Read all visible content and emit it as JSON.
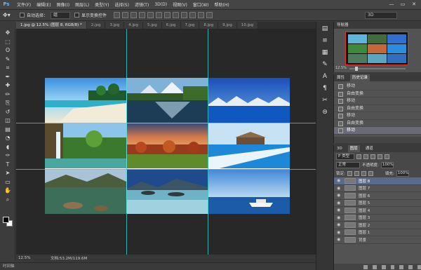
{
  "app": {
    "logo": "Ps"
  },
  "menu": [
    "文件(F)",
    "编辑(E)",
    "图像(I)",
    "图层(L)",
    "类型(Y)",
    "选择(S)",
    "滤镜(T)",
    "3D(D)",
    "视图(V)",
    "窗口(W)",
    "帮助(H)"
  ],
  "window_controls": [
    "—",
    "▭",
    "✕"
  ],
  "options": {
    "auto_select_label": "自动选择：",
    "auto_select_value": "组",
    "show_transform_label": "显示变换控件",
    "mode_3d": "3D"
  },
  "tabs": [
    {
      "label": "1.jpg @ 12.5% (图层 8, RGB/8) *",
      "active": true
    },
    {
      "label": "2.jpg",
      "active": false
    },
    {
      "label": "3.jpg",
      "active": false
    },
    {
      "label": "4.jpg",
      "active": false
    },
    {
      "label": "5.jpg",
      "active": false
    },
    {
      "label": "6.jpg",
      "active": false
    },
    {
      "label": "7.jpg",
      "active": false
    },
    {
      "label": "8.jpg",
      "active": false
    },
    {
      "label": "9.jpg",
      "active": false
    },
    {
      "label": "10.jpg",
      "active": false
    }
  ],
  "tools": [
    "move-tool",
    "marquee-tool",
    "lasso-tool",
    "quick-select-tool",
    "crop-tool",
    "eyedropper-tool",
    "healing-tool",
    "brush-tool",
    "stamp-tool",
    "history-brush-tool",
    "eraser-tool",
    "gradient-tool",
    "blur-tool",
    "dodge-tool",
    "pen-tool",
    "type-tool",
    "path-select-tool",
    "shape-tool",
    "hand-tool",
    "zoom-tool"
  ],
  "tool_glyphs": [
    "✥",
    "⬚",
    "ʘ",
    "✎",
    "⌗",
    "✒",
    "✚",
    "✏",
    "⎘",
    "↺",
    "◫",
    "▤",
    "◔",
    "◖",
    "✑",
    "T",
    "➤",
    "▭",
    "✋",
    "⌕"
  ],
  "status": {
    "zoom": "12.5%",
    "doc_info": "文档:53.2M/119.6M"
  },
  "timeline_label": "时间轴",
  "navigator": {
    "title": "导航器",
    "zoom": "12.5%"
  },
  "history": {
    "tabs": [
      "属性",
      "历史记录"
    ],
    "items": [
      {
        "label": "移动",
        "selected": false
      },
      {
        "label": "自由变换",
        "selected": false
      },
      {
        "label": "移动",
        "selected": false
      },
      {
        "label": "自由变换",
        "selected": false
      },
      {
        "label": "移动",
        "selected": false
      },
      {
        "label": "自由变换",
        "selected": false
      },
      {
        "label": "移动",
        "selected": true
      }
    ]
  },
  "layers": {
    "tabs": [
      "3D",
      "图层",
      "通道"
    ],
    "kind": "P 类型",
    "blend_mode": "正常",
    "opacity_label": "不透明度:",
    "opacity": "100%",
    "lock_label": "锁定:",
    "fill_label": "填充:",
    "fill": "100%",
    "items": [
      {
        "label": "图层 8",
        "selected": true
      },
      {
        "label": "图层 7",
        "selected": false
      },
      {
        "label": "图层 6",
        "selected": false
      },
      {
        "label": "图层 5",
        "selected": false
      },
      {
        "label": "图层 4",
        "selected": false
      },
      {
        "label": "图层 3",
        "selected": false
      },
      {
        "label": "图层 2",
        "selected": false
      },
      {
        "label": "图层 1",
        "selected": false
      },
      {
        "label": "背景",
        "selected": false
      }
    ]
  },
  "colors": {
    "guide": "#35d0d0",
    "nav_frame": "#e03030",
    "selection": "#5b6a8a"
  }
}
